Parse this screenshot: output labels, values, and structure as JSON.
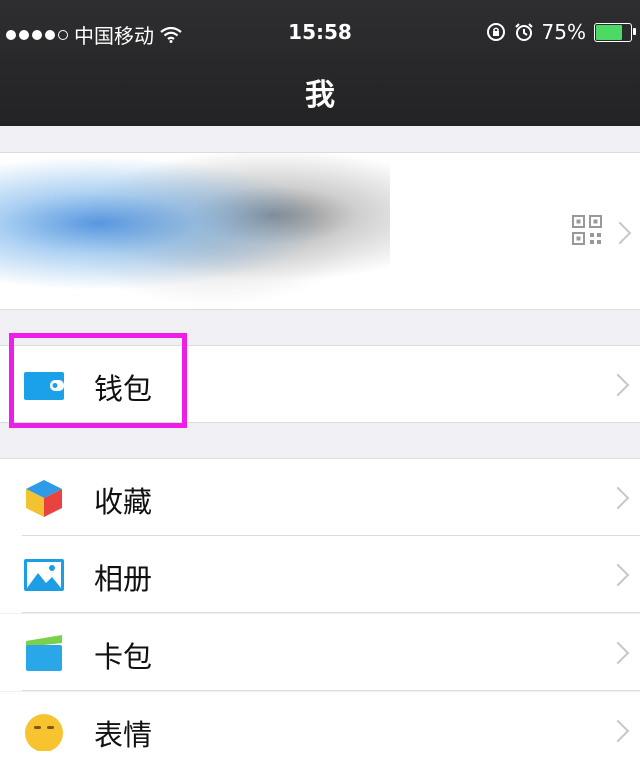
{
  "status_bar": {
    "carrier": "中国移动",
    "time": "15:58",
    "battery_percent": "75%",
    "battery_level": 0.75
  },
  "nav": {
    "title": "我"
  },
  "profile": {
    "qr_icon": "qr-code-icon",
    "chevron_icon": "chevron-right-icon"
  },
  "menu": {
    "wallet": {
      "label": "钱包",
      "icon": "wallet-icon",
      "color": "#1aa1e8"
    },
    "favorites": {
      "label": "收藏",
      "icon": "cube-icon"
    },
    "album": {
      "label": "相册",
      "icon": "photo-icon",
      "color": "#1c9de6"
    },
    "cards": {
      "label": "卡包",
      "icon": "card-icon"
    },
    "emoji": {
      "label": "表情",
      "icon": "emoji-icon",
      "color": "#f7c430"
    }
  },
  "highlight_color": "#ee1ee8"
}
